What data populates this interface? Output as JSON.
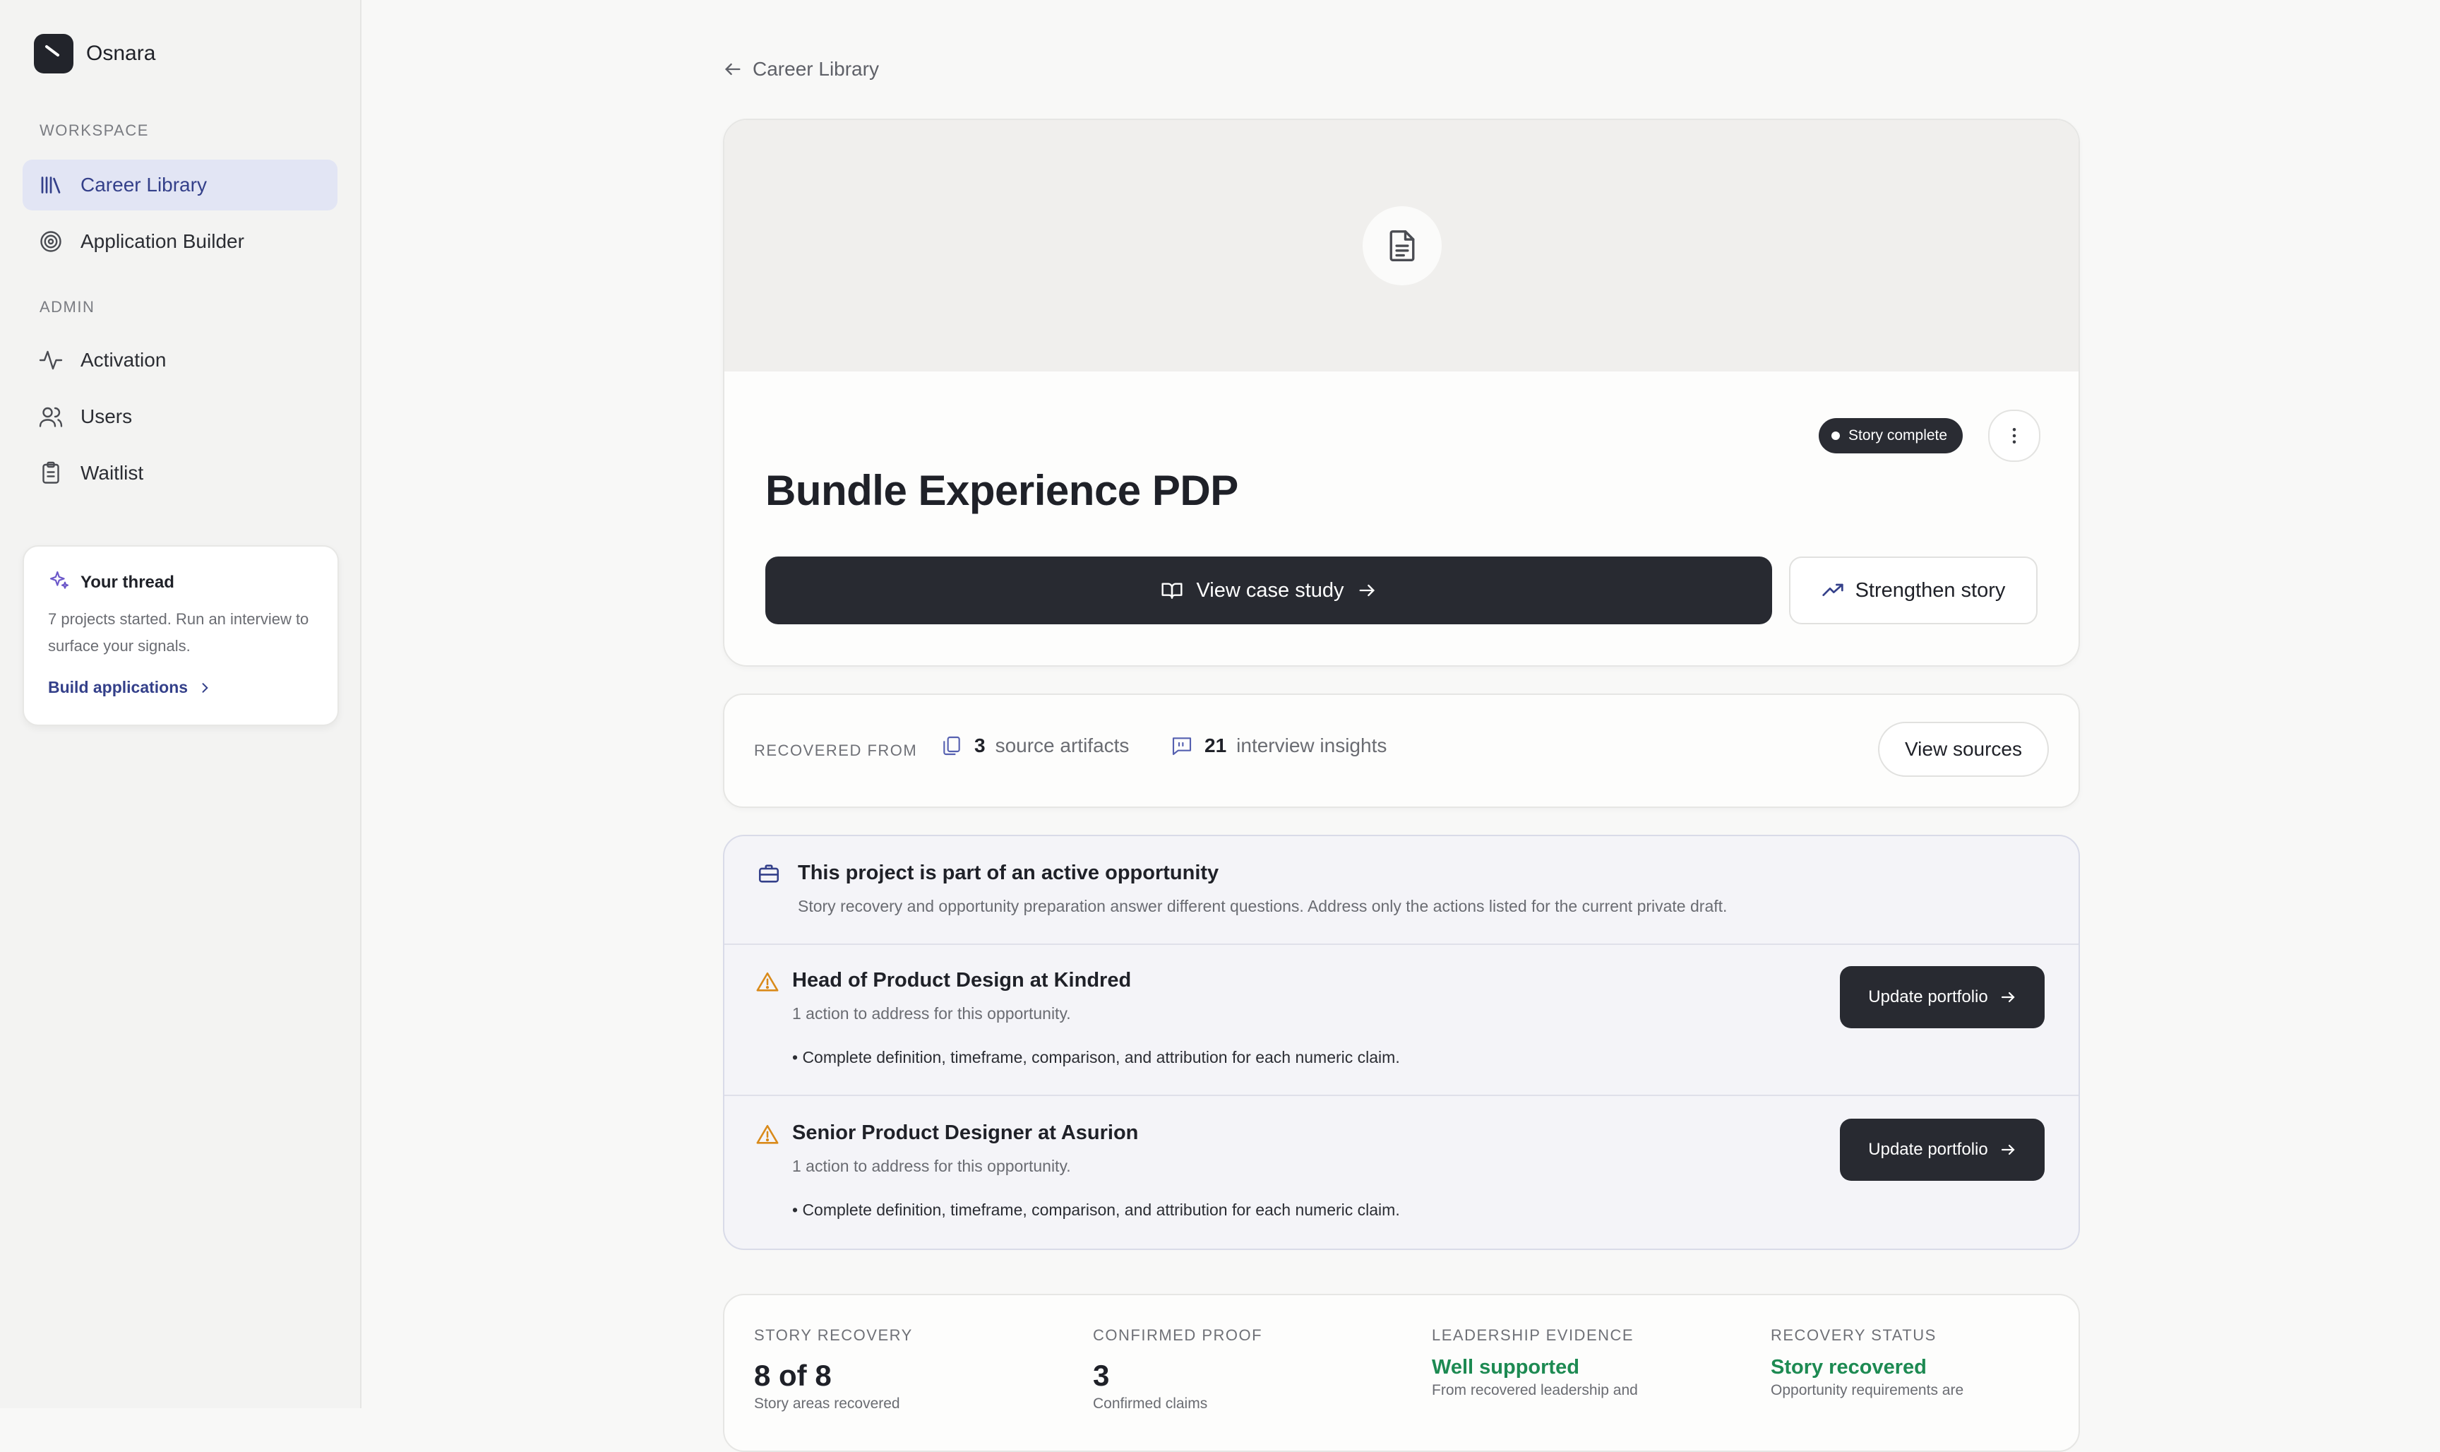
{
  "brand": {
    "name": "Osnara",
    "logo_icon": "osnara-logo-icon"
  },
  "sidebar": {
    "sections": [
      {
        "label": "WORKSPACE"
      },
      {
        "label": "ADMIN"
      }
    ],
    "items": [
      {
        "label": "Career Library",
        "icon": "library-icon",
        "active": true
      },
      {
        "label": "Application Builder",
        "icon": "target-icon",
        "active": false
      },
      {
        "label": "Activation",
        "icon": "activity-icon",
        "active": false
      },
      {
        "label": "Users",
        "icon": "users-icon",
        "active": false
      },
      {
        "label": "Waitlist",
        "icon": "clipboard-icon",
        "active": false
      }
    ],
    "thread_card": {
      "title": "Your thread",
      "body": "7 projects started. Run an interview to surface your signals.",
      "link": "Build applications"
    }
  },
  "breadcrumb": {
    "back_label": "Career Library"
  },
  "project": {
    "title": "Bundle Experience PDP",
    "status": "Story complete",
    "primary_action": "View case study",
    "secondary_action": "Strengthen story"
  },
  "sources": {
    "label": "RECOVERED FROM",
    "artifacts_count": "3",
    "artifacts_label": "source artifacts",
    "insights_count": "21",
    "insights_label": "interview insights",
    "button": "View sources"
  },
  "opportunity": {
    "title": "This project is part of an active opportunity",
    "description": "Story recovery and opportunity preparation answer different questions. Address only the actions listed for the current private draft.",
    "items": [
      {
        "role": "Head of Product Design at Kindred",
        "actions": "1 action to address for this opportunity.",
        "bullet": "• Complete definition, timeframe, comparison, and attribution for each numeric claim.",
        "button": "Update portfolio"
      },
      {
        "role": "Senior Product Designer at Asurion",
        "actions": "1 action to address for this opportunity.",
        "bullet": "• Complete definition, timeframe, comparison, and attribution for each numeric claim.",
        "button": "Update portfolio"
      }
    ]
  },
  "stats": [
    {
      "label": "STORY RECOVERY",
      "value": "8 of 8",
      "sub": "Story areas recovered"
    },
    {
      "label": "CONFIRMED PROOF",
      "value": "3",
      "sub": "Confirmed claims"
    },
    {
      "label": "LEADERSHIP EVIDENCE",
      "value": "Well supported",
      "sub": "From recovered leadership and"
    },
    {
      "label": "RECOVERY STATUS",
      "value": "Story recovered",
      "sub": "Opportunity requirements are"
    }
  ],
  "colors": {
    "accent": "#34408a",
    "dark": "#282a31",
    "success": "#1d8a52",
    "warning": "#d98a1a"
  }
}
